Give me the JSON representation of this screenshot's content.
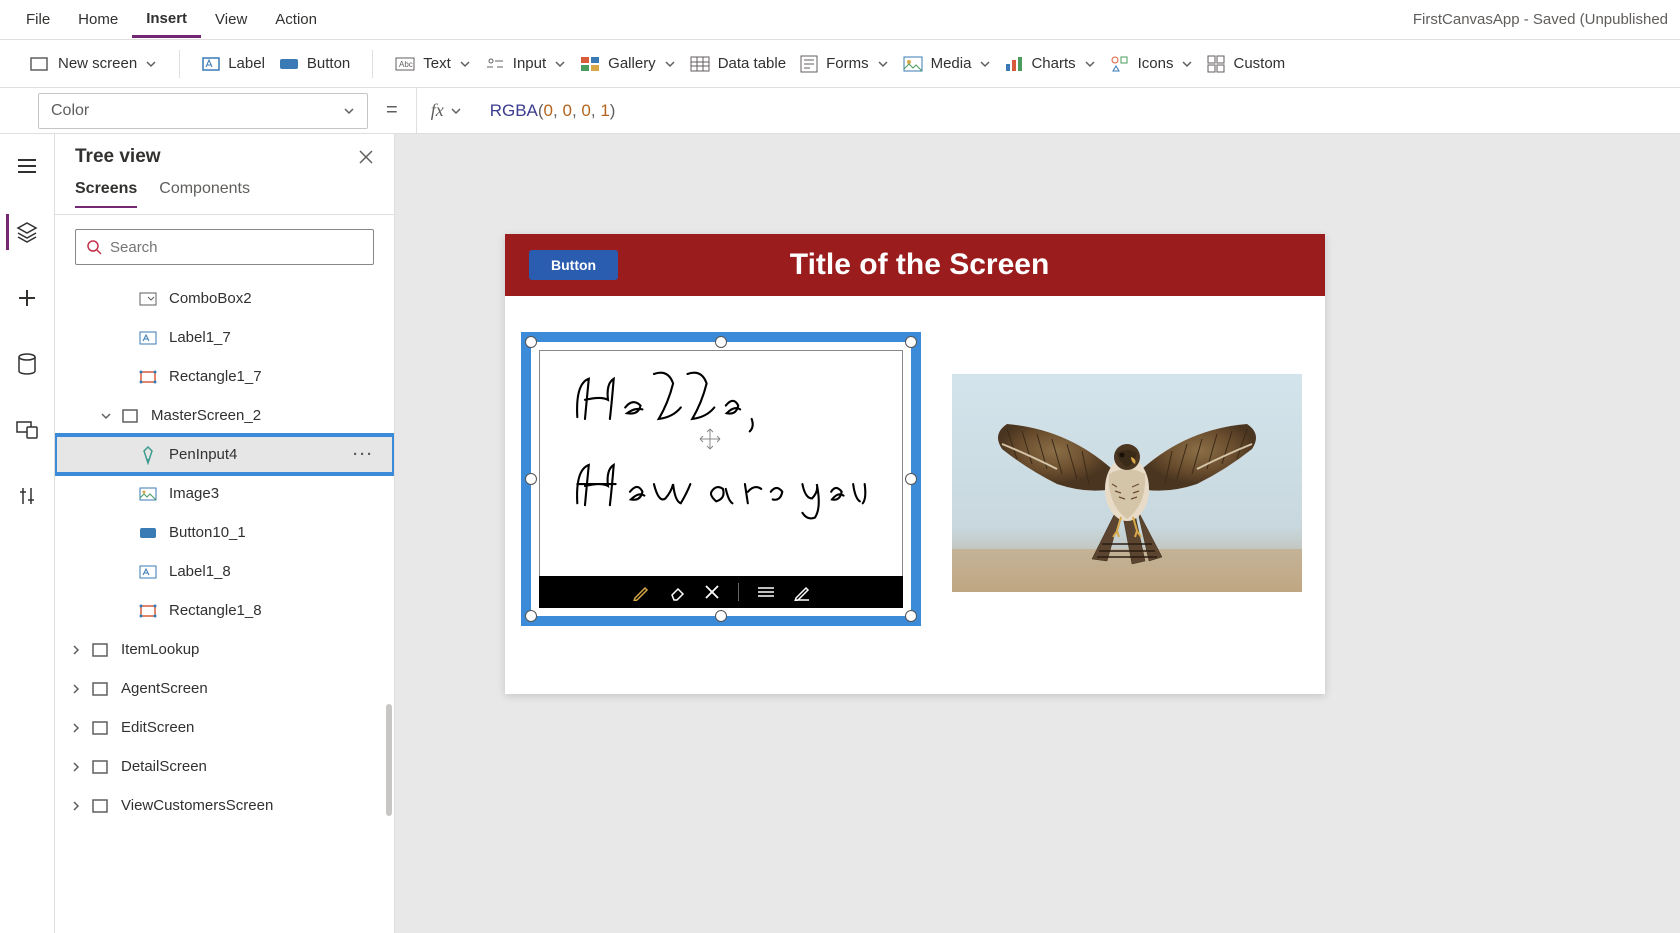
{
  "app_title": "FirstCanvasApp - Saved (Unpublished",
  "menu": {
    "items": [
      "File",
      "Home",
      "Insert",
      "View",
      "Action"
    ],
    "active": 2
  },
  "ribbon": {
    "new_screen": "New screen",
    "label": "Label",
    "button": "Button",
    "text": "Text",
    "input": "Input",
    "gallery": "Gallery",
    "data_table": "Data table",
    "forms": "Forms",
    "media": "Media",
    "charts": "Charts",
    "icons": "Icons",
    "custom": "Custom"
  },
  "formula": {
    "property": "Color",
    "eq": "=",
    "fn": "RGBA",
    "args": [
      "0",
      "0",
      "0",
      "1"
    ]
  },
  "tree": {
    "title": "Tree view",
    "tabs": [
      "Screens",
      "Components"
    ],
    "active_tab": 0,
    "search_placeholder": "Search",
    "items": [
      {
        "label": "ComboBox2",
        "icon": "dropdown",
        "depth": 2,
        "selected": false
      },
      {
        "label": "Label1_7",
        "icon": "label",
        "depth": 2,
        "selected": false
      },
      {
        "label": "Rectangle1_7",
        "icon": "rect",
        "depth": 2,
        "selected": false
      },
      {
        "label": "MasterScreen_2",
        "icon": "screen",
        "depth": 1,
        "expanded": true,
        "selected": false
      },
      {
        "label": "PenInput4",
        "icon": "pen",
        "depth": 2,
        "selected": true
      },
      {
        "label": "Image3",
        "icon": "image",
        "depth": 2,
        "selected": false
      },
      {
        "label": "Button10_1",
        "icon": "button",
        "depth": 2,
        "selected": false
      },
      {
        "label": "Label1_8",
        "icon": "label",
        "depth": 2,
        "selected": false
      },
      {
        "label": "Rectangle1_8",
        "icon": "rect",
        "depth": 2,
        "selected": false
      },
      {
        "label": "ItemLookup",
        "icon": "screen",
        "depth": 0,
        "expanded": false,
        "selected": false
      },
      {
        "label": "AgentScreen",
        "icon": "screen",
        "depth": 0,
        "expanded": false,
        "selected": false
      },
      {
        "label": "EditScreen",
        "icon": "screen",
        "depth": 0,
        "expanded": false,
        "selected": false
      },
      {
        "label": "DetailScreen",
        "icon": "screen",
        "depth": 0,
        "expanded": false,
        "selected": false
      },
      {
        "label": "ViewCustomersScreen",
        "icon": "screen",
        "depth": 0,
        "expanded": false,
        "selected": false
      }
    ]
  },
  "screen": {
    "button_label": "Button",
    "title": "Title of the Screen"
  },
  "pen": {
    "handwriting_line1": "Hello,",
    "handwriting_line2": "How are you"
  }
}
